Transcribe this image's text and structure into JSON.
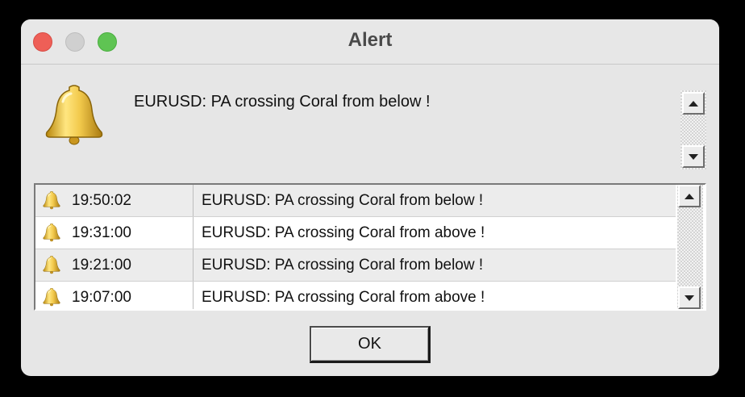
{
  "window": {
    "title": "Alert"
  },
  "icons": {
    "big": "bell-icon",
    "row": "bell-icon"
  },
  "message": "EURUSD: PA crossing Coral from below !",
  "alerts": [
    {
      "time": "19:50:02",
      "text": "EURUSD: PA crossing Coral from below !"
    },
    {
      "time": "19:31:00",
      "text": "EURUSD: PA crossing Coral from above !"
    },
    {
      "time": "19:21:00",
      "text": "EURUSD: PA crossing Coral from below !"
    },
    {
      "time": "19:07:00",
      "text": "EURUSD: PA crossing Coral from above !"
    }
  ],
  "ok_label": "OK",
  "colors": {
    "close": "#ee5f57",
    "minimize": "#d0d0d0",
    "maximize": "#5fc453",
    "bell": "#e8c33a"
  }
}
